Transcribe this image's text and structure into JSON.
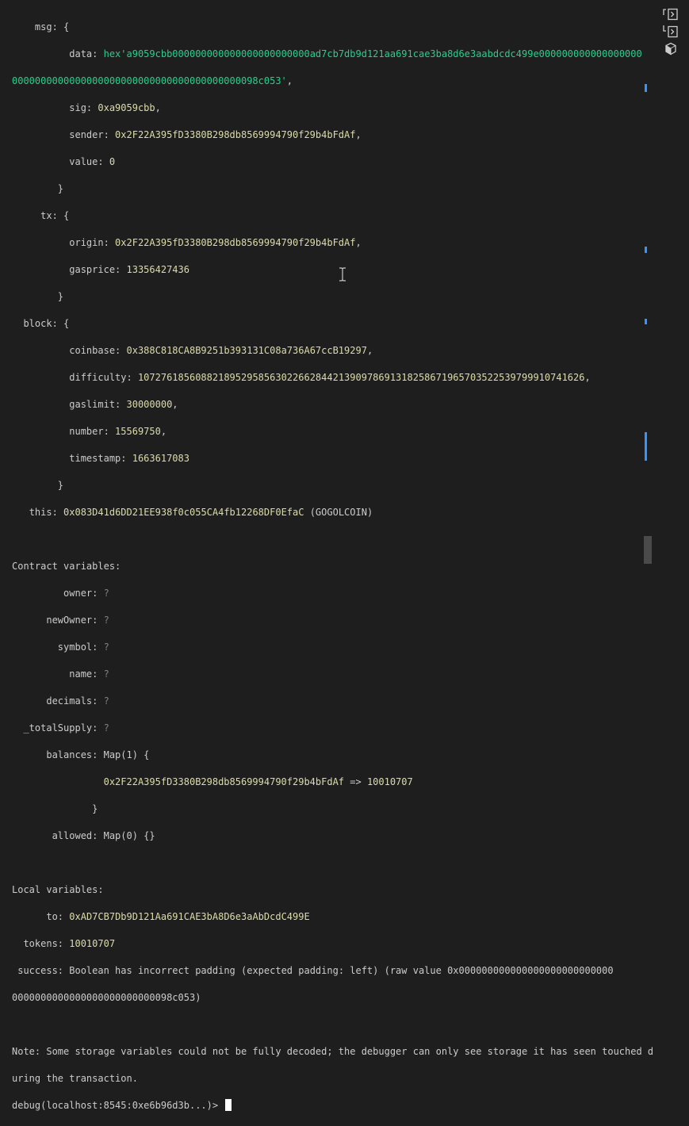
{
  "terminal": {
    "msg_label": "msg: {",
    "data_key": "data: ",
    "data_line1": "hex'a9059cbb000000000000000000000000ad7cb7db9d121aa691cae3ba8d6e3aabdcdc499e000000000000000000",
    "data_line2": "0000000000000000000000000000000000000000098c053'",
    "data_comma": ",",
    "sig_key": "sig: ",
    "sig_val": "0xa9059cbb",
    "sender_key": "sender: ",
    "sender_val": "0x2F22A395fD3380B298db8569994790f29b4bFdAf",
    "value_key": "value: ",
    "value_val": "0",
    "close_brace": "}",
    "tx_label": "tx: {",
    "origin_key": "origin: ",
    "origin_val": "0x2F22A395fD3380B298db8569994790f29b4bFdAf",
    "gasprice_key": "gasprice: ",
    "gasprice_val": "13356427436",
    "block_label": "block: {",
    "coinbase_key": "coinbase: ",
    "coinbase_val": "0x388C818CA8B9251b393131C08a736A67ccB19297",
    "difficulty_key": "difficulty: ",
    "difficulty_val": "107276185608821895295856302266284421390978691318258671965703522539799910741626",
    "gaslimit_key": "gaslimit: ",
    "gaslimit_val": "30000000",
    "number_key": "number: ",
    "number_val": "15569750",
    "timestamp_key": "timestamp: ",
    "timestamp_val": "1663617083",
    "this_key": "this: ",
    "this_val": "0x083D41d6DD21EE938f0c055CA4fb12268DF0EfaC",
    "this_name": " (GOGOLCOIN)",
    "contract_vars_title": "Contract variables:",
    "owner_key": "owner: ",
    "newowner_key": "newOwner: ",
    "symbol_key": "symbol: ",
    "name_key": "name: ",
    "decimals_key": "decimals: ",
    "totalsupply_key": "_totalSupply: ",
    "unknown": "?",
    "balances_key": "balances: ",
    "balances_val": "Map(1) {",
    "balances_addr": "0x2F22A395fD3380B298db8569994790f29b4bFdAf",
    "arrow": " => ",
    "balances_amount": "10010707",
    "allowed_key": "allowed: ",
    "allowed_val": "Map(0) {}",
    "local_vars_title": "Local variables:",
    "to_key": "to: ",
    "to_val": "0xAD7CB7Db9D121Aa691CAE3bA8D6e3aAbDcdC499E",
    "tokens_key": "tokens: ",
    "tokens_val": "10010707",
    "success_line1": "success: Boolean has incorrect padding (expected padding: left) (raw value 0x000000000000000000000000000",
    "success_line2": "0000000000000000000000000098c053)",
    "note_line1": "Note: Some storage variables could not be fully decoded; the debugger can only see storage it has seen touched d",
    "note_line2": "uring the transaction.",
    "prompt": "debug(localhost:8545:0xe6b96d3b...)> "
  },
  "colors": {
    "background": "#1e1e1e",
    "default_text": "#cccccc",
    "value_yellow": "#dcdcaa",
    "hex_green": "#23d18b",
    "unknown_gray": "#808080",
    "overview_ruler": "#3794ff"
  },
  "icons": {
    "side_icons": [
      "terminal-split-icon",
      "terminal-new-icon",
      "cube-icon"
    ],
    "cursor": "text-ibeam-icon"
  }
}
